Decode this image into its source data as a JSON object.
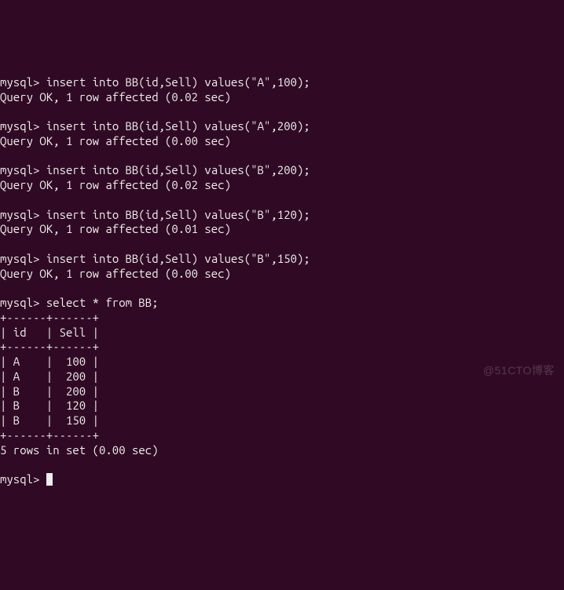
{
  "prompt": "mysql> ",
  "blocks": [
    {
      "cmd": "insert into BB(id,Sell) values(\"A\",100);",
      "result": "Query OK, 1 row affected (0.02 sec)"
    },
    {
      "cmd": "insert into BB(id,Sell) values(\"A\",200);",
      "result": "Query OK, 1 row affected (0.00 sec)"
    },
    {
      "cmd": "insert into BB(id,Sell) values(\"B\",200);",
      "result": "Query OK, 1 row affected (0.02 sec)"
    },
    {
      "cmd": "insert into BB(id,Sell) values(\"B\",120);",
      "result": "Query OK, 1 row affected (0.01 sec)"
    },
    {
      "cmd": "insert into BB(id,Sell) values(\"B\",150);",
      "result": "Query OK, 1 row affected (0.00 sec)"
    }
  ],
  "select_cmd": "select * from BB;",
  "table": {
    "border": "+------+------+",
    "header": "| id   | Sell |",
    "rows": [
      "| A    |  100 |",
      "| A    |  200 |",
      "| B    |  200 |",
      "| B    |  120 |",
      "| B    |  150 |"
    ]
  },
  "footer": "5 rows in set (0.00 sec)",
  "watermark": "@51CTO博客"
}
